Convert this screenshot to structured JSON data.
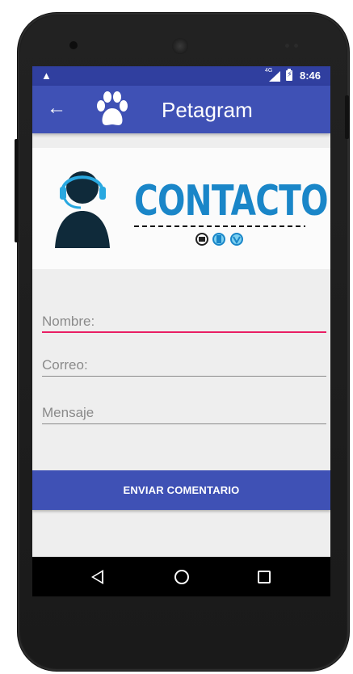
{
  "status_bar": {
    "alert_symbol": "▲",
    "network": "4G",
    "time": "8:46"
  },
  "app_bar": {
    "back_symbol": "←",
    "title": "Petagram"
  },
  "banner": {
    "heading": "CONTACTO"
  },
  "form": {
    "nombre_placeholder": "Nombre:",
    "correo_placeholder": "Correo:",
    "mensaje_placeholder": "Mensaje",
    "submit_label": "ENVIAR COMENTARIO"
  },
  "colors": {
    "status_bar": "#303f9f",
    "primary": "#3f51b5",
    "accent": "#e91e63",
    "contact_blue": "#1a86c8"
  },
  "icons": [
    "warning-icon",
    "signal-icon",
    "battery-icon",
    "back-arrow-icon",
    "paw-icon",
    "headset-agent-icon",
    "nav-back-icon",
    "nav-home-icon",
    "nav-recents-icon"
  ]
}
